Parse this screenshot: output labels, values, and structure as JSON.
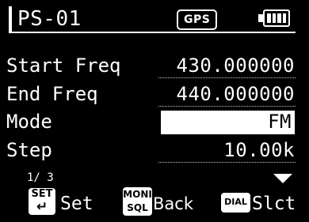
{
  "header": {
    "title": "PS-01",
    "gps_badge": "GPS",
    "battery_icon": "battery-full-icon",
    "battery_level": 1.0
  },
  "settings": {
    "rows": [
      {
        "label": "Start Freq",
        "value": "430.000000",
        "selected": false
      },
      {
        "label": "End Freq",
        "value": "440.000000",
        "selected": false
      },
      {
        "label": "Mode",
        "value": "FM",
        "selected": true
      },
      {
        "label": "Step",
        "value": "10.00k",
        "selected": false
      }
    ]
  },
  "footer": {
    "page_indicator": "1/ 3",
    "keys": {
      "set": {
        "line1": "SET",
        "icon": "↵",
        "label": "Set"
      },
      "moni": {
        "line1": "MONI",
        "line2": "SQL",
        "label": "Back"
      },
      "dial": {
        "line1": "DIAL",
        "label": "Slct"
      }
    },
    "more_icon": "scroll-down-arrow-icon"
  },
  "colors": {
    "background": "#000000",
    "foreground": "#ffffff",
    "selection": "#ffffff"
  }
}
